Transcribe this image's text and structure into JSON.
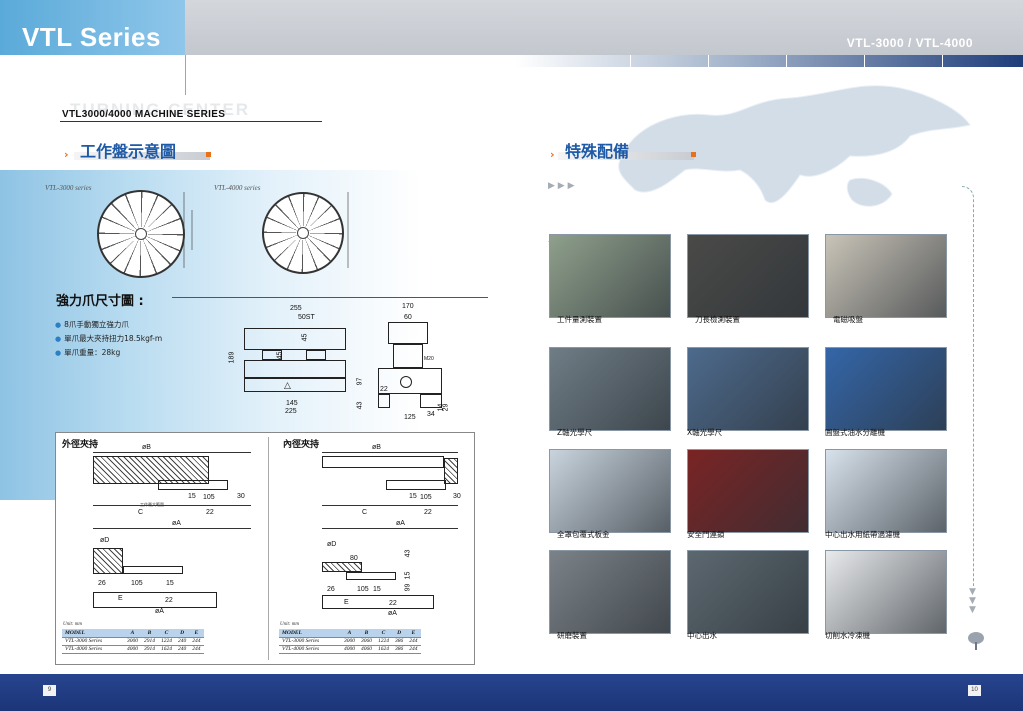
{
  "header": {
    "brand_title": "VTL Series",
    "model_title": "VTL-3000 / VTL-4000",
    "ghost_text": "TURNING CENTER",
    "series_heading": "VTL3000/4000 MACHINE SERIES"
  },
  "left": {
    "section_title": "工作盤示意圖",
    "chuck_captions": [
      "VTL-3000 series",
      "VTL-4000 series"
    ],
    "strong_title": "強力爪尺寸圖 :",
    "bullets": [
      "8爪手動獨立強力爪",
      "單爪最大夾持扭力18.5kgf-m",
      "單爪重量：28kg"
    ],
    "dims": {
      "d255": "255",
      "d50st": "50ST",
      "d170": "170",
      "d60": "60",
      "d45a": "45",
      "d45b": "45",
      "d189": "189",
      "d97": "97",
      "d22": "22",
      "d43": "43",
      "d145": "145",
      "d225": "225",
      "d125": "125",
      "d34": "34",
      "d14": "14",
      "d29": "29",
      "m20": "M20"
    },
    "outer": {
      "title": "外徑夾持",
      "labels": {
        "oB": "øB",
        "d15": "15",
        "d105": "105",
        "d30": "30",
        "C": "C",
        "d22": "22",
        "oA": "øA",
        "oD": "øD",
        "d26": "26",
        "d105b": "105",
        "d15b": "15",
        "E": "E",
        "d22b": "22",
        "oA2": "øA",
        "work": "工作最大範圍"
      },
      "unit": "Unit: mm",
      "table": {
        "headers": [
          "MODEL",
          "A",
          "B",
          "C",
          "D",
          "E"
        ],
        "rows": [
          [
            "VTL-3000 Series",
            "3000",
            "2914",
            "1224",
            "240",
            "244"
          ],
          [
            "VTL-4000 Series",
            "4000",
            "3914",
            "1624",
            "240",
            "244"
          ]
        ]
      }
    },
    "inner": {
      "title": "內徑夾持",
      "labels": {
        "oB": "øB",
        "d15": "15",
        "d105": "105",
        "d30": "30",
        "C": "C",
        "d22": "22",
        "oA": "øA",
        "oD": "øD",
        "d80": "80",
        "d43": "43",
        "d15v": "15",
        "d99": "99",
        "d26": "26",
        "d105b": "105",
        "d15b": "15",
        "E": "E",
        "d22b": "22",
        "oA2": "øA"
      },
      "unit": "Unit: mm",
      "table": {
        "headers": [
          "MODEL",
          "A",
          "B",
          "C",
          "D",
          "E"
        ],
        "rows": [
          [
            "VTL-3000 Series",
            "3000",
            "3060",
            "1224",
            "386",
            "244"
          ],
          [
            "VTL-4000 Series",
            "4000",
            "4060",
            "1624",
            "386",
            "244"
          ]
        ]
      }
    }
  },
  "right": {
    "section_title": "特殊配備",
    "accessories": [
      {
        "label": "工件量測裝置",
        "bg": "#8fa08c"
      },
      {
        "label": "刀長檢測裝置",
        "bg": "#4a4a48"
      },
      {
        "label": "電磁吸盤",
        "bg": "#c9c4b8"
      },
      {
        "label": "Z軸光學尺",
        "bg": "#6f7d86"
      },
      {
        "label": "X軸光學尺",
        "bg": "#4d6a8c"
      },
      {
        "label": "圓盤式油水分離機",
        "bg": "#3466a8"
      },
      {
        "label": "全罩包覆式板金",
        "bg": "#c9d4de"
      },
      {
        "label": "安全門連鎖",
        "bg": "#7a2424"
      },
      {
        "label": "中心出水用紙帶過濾機",
        "bg": "#d8e2ec"
      },
      {
        "label": "研磨裝置",
        "bg": "#7b8288"
      },
      {
        "label": "中心出水",
        "bg": "#5c6870"
      },
      {
        "label": "切削水冷凍機",
        "bg": "#e8eaec"
      }
    ]
  },
  "footer": {
    "page_left": "9",
    "page_right": "10"
  },
  "colors": {
    "accent_blue": "#1e5aa8",
    "footer_navy": "#1c3578",
    "accent_orange": "#e8701a"
  }
}
